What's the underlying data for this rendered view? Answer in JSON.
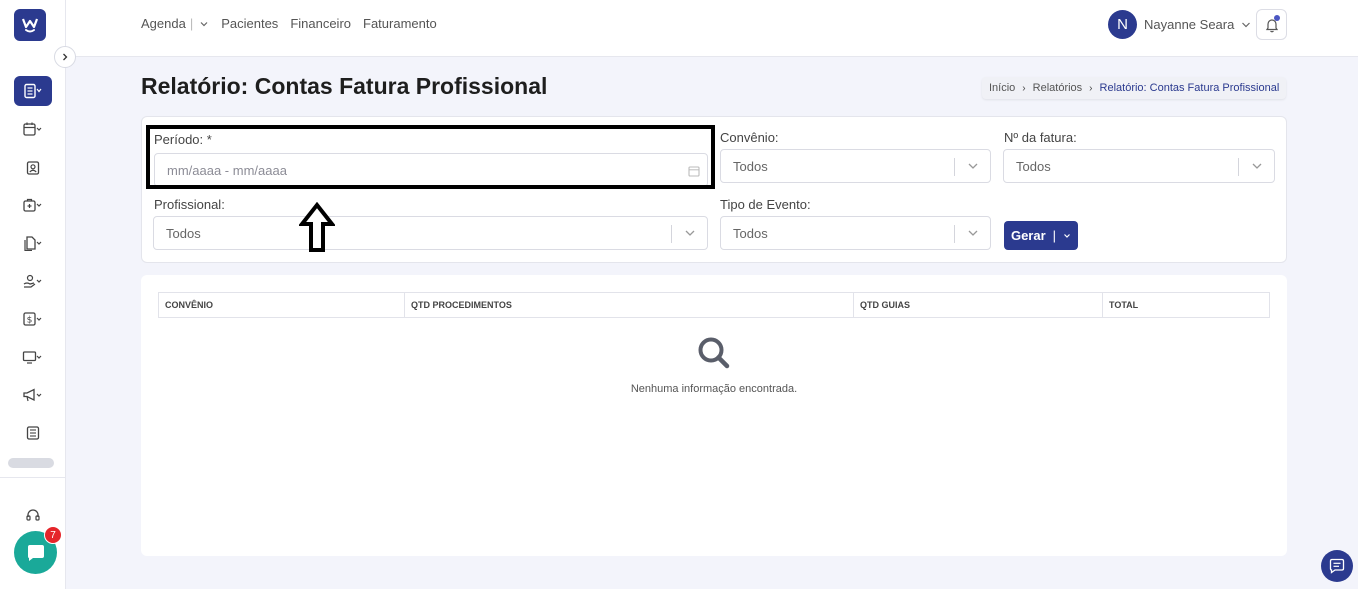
{
  "topnav": {
    "agenda": "Agenda",
    "agenda_sep": "|",
    "pacientes": "Pacientes",
    "financeiro": "Financeiro",
    "faturamento": "Faturamento"
  },
  "user": {
    "initial": "N",
    "name": "Nayanne Seara"
  },
  "page": {
    "title": "Relatório: Contas Fatura Profissional"
  },
  "breadcrumb": {
    "home": "Início",
    "reports": "Relatórios",
    "current": "Relatório: Contas Fatura Profissional"
  },
  "filters": {
    "periodo": {
      "label": "Período: *",
      "placeholder": "mm/aaaa - mm/aaaa"
    },
    "convenio": {
      "label": "Convênio:",
      "value": "Todos"
    },
    "fatura": {
      "label": "Nº da fatura:",
      "value": "Todos"
    },
    "profissional": {
      "label": "Profissional:",
      "value": "Todos"
    },
    "tipo_evento": {
      "label": "Tipo de Evento:",
      "value": "Todos"
    },
    "gerar_label": "Gerar",
    "gerar_sep": "|"
  },
  "table": {
    "columns": [
      "CONVÊNIO",
      "QTD PROCEDIMENTOS",
      "QTD GUIAS",
      "TOTAL"
    ],
    "empty_text": "Nenhuma informação encontrada."
  },
  "chat": {
    "badge": "7"
  },
  "colors": {
    "primary": "#2b3a8f",
    "chat": "#1aa999",
    "badge": "#e5252a"
  }
}
